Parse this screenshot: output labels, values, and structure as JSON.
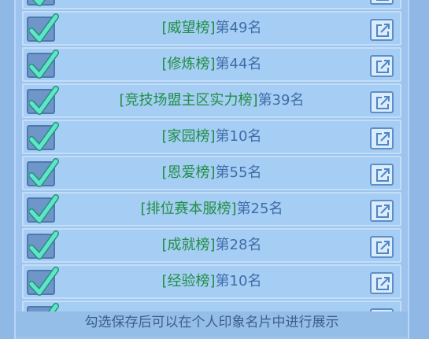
{
  "rows": [
    {
      "name": "",
      "rank": ""
    },
    {
      "name": "[威望榜]",
      "rank": "第49名"
    },
    {
      "name": "[修炼榜]",
      "rank": "第44名"
    },
    {
      "name": "[竞技场盟主区实力榜]",
      "rank": "第39名"
    },
    {
      "name": "[家园榜]",
      "rank": "第10名"
    },
    {
      "name": "[恩爱榜]",
      "rank": "第55名"
    },
    {
      "name": "[排位赛本服榜]",
      "rank": "第25名"
    },
    {
      "name": "[成就榜]",
      "rank": "第28名"
    },
    {
      "name": "[经验榜]",
      "rank": "第10名"
    },
    {
      "name": "",
      "rank": ""
    }
  ],
  "footer": {
    "hint": "勾选保存后可以在个人印象名片中进行展示"
  },
  "colors": {
    "name_green": "#1f8f45",
    "rank_blue": "#3f6da8",
    "row_bg": "#a6cdf4",
    "check_teal": "#5fe6c8"
  }
}
